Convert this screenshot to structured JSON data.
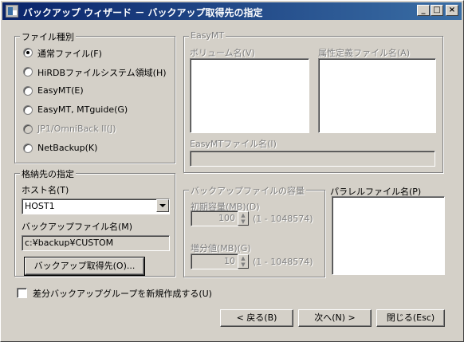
{
  "window": {
    "title": "バックアップ ウィザード － バックアップ取得先の指定",
    "minimize": "_",
    "maximize": "□",
    "close": "×"
  },
  "file_type": {
    "legend": "ファイル種別",
    "options": [
      {
        "label": "通常ファイル(F)",
        "selected": true,
        "enabled": true
      },
      {
        "label": "HiRDBファイルシステム領域(H)",
        "selected": false,
        "enabled": true
      },
      {
        "label": "EasyMT(E)",
        "selected": false,
        "enabled": true
      },
      {
        "label": "EasyMT, MTguide(G)",
        "selected": false,
        "enabled": true
      },
      {
        "label": "JP1/OmniBack II(J)",
        "selected": false,
        "enabled": false
      },
      {
        "label": "NetBackup(K)",
        "selected": false,
        "enabled": true
      }
    ]
  },
  "easymt": {
    "legend": "EasyMT",
    "volume_label": "ボリューム名(V)",
    "attr_label": "属性定義ファイル名(A)",
    "file_label": "EasyMTファイル名(I)",
    "file_value": ""
  },
  "storage": {
    "legend": "格納先の指定",
    "host_label": "ホスト名(T)",
    "host_value": "HOST1",
    "file_label": "バックアップファイル名(M)",
    "file_value": "c:¥backup¥CUSTOM",
    "browse_button": "バックアップ取得先(O)..."
  },
  "capacity": {
    "legend": "バックアップファイルの容量",
    "initial_label": "初期容量(MB)(D)",
    "initial_value": "100",
    "initial_range": "(1 - 1048574)",
    "increment_label": "増分値(MB)(G)",
    "increment_value": "10",
    "increment_range": "(1 - 1048574)"
  },
  "parallel": {
    "label": "パラレルファイル名(P)"
  },
  "diff_group": {
    "label": "差分バックアップグループを新規作成する(U)",
    "checked": false
  },
  "buttons": {
    "back": "< 戻る(B)",
    "next": "次へ(N) >",
    "close": "閉じる(Esc)"
  }
}
